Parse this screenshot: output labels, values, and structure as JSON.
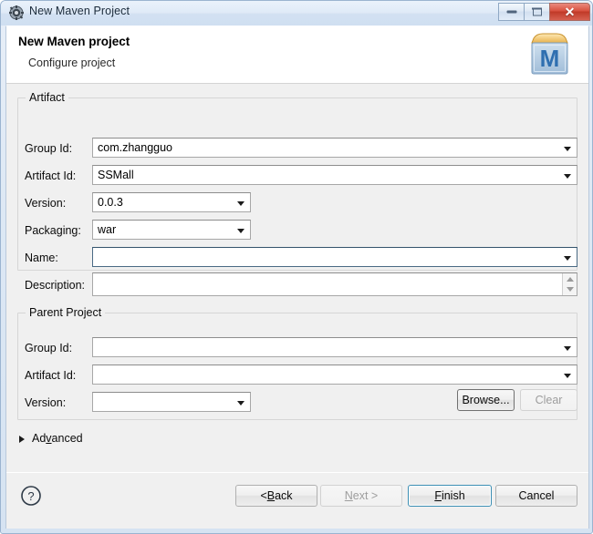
{
  "window": {
    "title": "New Maven Project",
    "title_icon": "maven-gear-icon",
    "controls": {
      "minimize": "minimize-icon",
      "maximize": "maximize-icon",
      "close": "close-icon",
      "close_glyph": "✕"
    }
  },
  "header": {
    "title": "New Maven project",
    "subtitle": "Configure project",
    "icon": "maven-project-icon"
  },
  "artifact": {
    "group_label": "Artifact",
    "fields": [
      {
        "label": "Group Id:",
        "value": "com.zhangguo",
        "placeholder": "",
        "combo": true,
        "wide": true,
        "focused": false
      },
      {
        "label": "Artifact Id:",
        "value": "SSMall",
        "placeholder": "",
        "combo": true,
        "wide": true,
        "focused": false
      },
      {
        "label": "Version:",
        "value": "0.0.3",
        "placeholder": "",
        "combo": true,
        "wide": false,
        "focused": false
      },
      {
        "label": "Packaging:",
        "value": "war",
        "placeholder": "",
        "combo": true,
        "wide": false,
        "focused": false
      },
      {
        "label": "Name:",
        "value": "",
        "placeholder": "",
        "combo": true,
        "wide": true,
        "focused": true
      }
    ],
    "description": {
      "label": "Description:",
      "value": "",
      "placeholder": ""
    }
  },
  "parent": {
    "group_label": "Parent Project",
    "fields": [
      {
        "label": "Group Id:",
        "value": "",
        "placeholder": "",
        "combo": true,
        "wide": true,
        "focused": false
      },
      {
        "label": "Artifact Id:",
        "value": "",
        "placeholder": "",
        "combo": true,
        "wide": true,
        "focused": false
      },
      {
        "label": "Version:",
        "value": "",
        "placeholder": "",
        "combo": true,
        "wide": false,
        "focused": false
      }
    ],
    "browse_label": "Browse...",
    "clear_label": "Clear",
    "clear_disabled": true
  },
  "advanced": {
    "label_before": "Ad",
    "label_mnemonic": "v",
    "label_after": "anced",
    "expanded": false
  },
  "footer": {
    "help_icon": "help-question-icon",
    "buttons": [
      {
        "name": "back",
        "before": "< ",
        "mnemonic": "B",
        "after": "ack",
        "disabled": false,
        "default": false
      },
      {
        "name": "next",
        "before": "",
        "mnemonic": "N",
        "after": "ext >",
        "disabled": true,
        "default": false
      },
      {
        "name": "finish",
        "before": "",
        "mnemonic": "F",
        "after": "inish",
        "disabled": false,
        "default": true
      },
      {
        "name": "cancel",
        "before": "Cancel",
        "mnemonic": "",
        "after": "",
        "disabled": false,
        "default": false
      }
    ]
  },
  "colors": {
    "accent": "#3c8fb4",
    "dialog_bg": "#f0f0f0",
    "header_bg": "#ffffff",
    "close_red": "#c03a28"
  }
}
